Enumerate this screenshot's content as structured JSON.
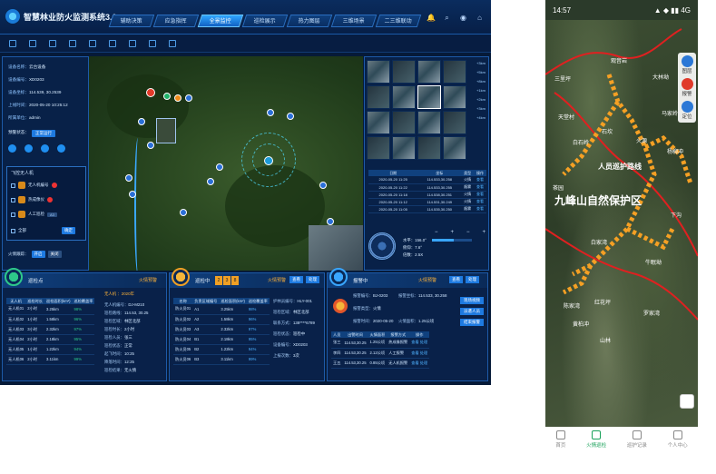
{
  "desktop": {
    "title": "智慧林业防火监测系统3.0",
    "nav_tabs": [
      "辅助决策",
      "应急指挥",
      "全景监控",
      "巡检展示",
      "热力图层",
      "三维场景",
      "二三维联动"
    ],
    "active_tab": 2,
    "left_panel": {
      "rows": [
        {
          "k": "设备名称：",
          "v": "云台设备"
        },
        {
          "k": "设备编号：",
          "v": "XD0203"
        },
        {
          "k": "设备坐标：",
          "v": "114.539, 30.2539"
        },
        {
          "k": "上线时间：",
          "v": "2020-05-20 10:25:12"
        },
        {
          "k": "所属单位：",
          "v": "admin"
        }
      ],
      "status_label": "预警状态：",
      "status_badge": "正常运行",
      "drone_section_title": "飞控无人机",
      "drones": [
        {
          "name": "无人机编号",
          "code": "A1"
        },
        {
          "name": "热成像仪",
          "code": "A2"
        },
        {
          "name": "人工巡检",
          "code": "A3"
        }
      ],
      "all_label": "全部",
      "all_btn": "确定",
      "follow_label": "火情跟踪：",
      "follow_btns": [
        "开启",
        "关闭"
      ]
    },
    "right_panel": {
      "ranges": [
        "+3km",
        "+5km",
        "+8km",
        "+1km",
        "+2km",
        "+3km",
        "+4km"
      ],
      "table_headers": [
        "日期",
        "坐标",
        "类型",
        "操作"
      ],
      "table_rows": [
        {
          "date": "2020-05-20 11:25",
          "coord": "114.533,30.258",
          "type": "火情",
          "op": "查看"
        },
        {
          "date": "2020-05-20 11:22",
          "coord": "114.533,30.255",
          "type": "烟雾",
          "op": "查看"
        },
        {
          "date": "2020-05-20 11:18",
          "coord": "114.538,30.251",
          "type": "火情",
          "op": "查看"
        },
        {
          "date": "2020-05-20 11:12",
          "coord": "114.531,30.249",
          "type": "火情",
          "op": "查看"
        },
        {
          "date": "2020-05-20 11:05",
          "coord": "114.535,30.250",
          "type": "烟雾",
          "op": "查看"
        }
      ],
      "dial": {
        "pan": "水平：156.0°",
        "tilt": "俯仰：7.6°",
        "zoom": "倍数：2.5X"
      },
      "slider_value": 0.55
    },
    "bottom": [
      {
        "title": "巡检点",
        "tag": "火情预警",
        "headers": [
          "无人机",
          "巡检时长",
          "巡检面积(km²)",
          "巡检覆盖率"
        ],
        "rows": [
          [
            "无人机01",
            "2小时",
            "3.25km",
            "98%"
          ],
          [
            "无人机02",
            "1小时",
            "1.58km",
            "96%"
          ],
          [
            "无人机03",
            "3小时",
            "2.32km",
            "97%"
          ],
          [
            "无人机04",
            "2小时",
            "2.18km",
            "95%"
          ],
          [
            "无人机05",
            "1小时",
            "1.22km",
            "94%"
          ],
          [
            "无人机06",
            "2小时",
            "3.11km",
            "99%"
          ]
        ],
        "detail_title": "无人机 ：2020年",
        "detail": [
          {
            "k": "无人机编号：",
            "v": "DJ-M210"
          },
          {
            "k": "巡检路线：",
            "v": "114.53, 30.25"
          },
          {
            "k": "巡检区域：",
            "v": "林区北部"
          },
          {
            "k": "巡检时长：",
            "v": "2小时"
          },
          {
            "k": "巡检人员：",
            "v": "张三"
          },
          {
            "k": "巡检状态：",
            "v": "正常"
          },
          {
            "k": "起飞时间：",
            "v": "10:25"
          },
          {
            "k": "降落时间：",
            "v": "12:25"
          },
          {
            "k": "巡检结果：",
            "v": "无火情"
          }
        ]
      },
      {
        "title": "巡检中",
        "counter": [
          "2",
          "3",
          "8"
        ],
        "tag": "火情预警",
        "btns": [
          "查看",
          "处理"
        ],
        "headers": [
          "名称",
          "负责区域编号",
          "巡检面积(km²)",
          "巡检覆盖率"
        ],
        "rows": [
          [
            "防火员01",
            "A1",
            "3.25km",
            "98%"
          ],
          [
            "防火员02",
            "A2",
            "1.58km",
            "96%"
          ],
          [
            "防火员03",
            "A3",
            "2.32km",
            "97%"
          ],
          [
            "防火员04",
            "B1",
            "2.18km",
            "95%"
          ],
          [
            "防火员05",
            "B2",
            "1.22km",
            "94%"
          ],
          [
            "防火员06",
            "B3",
            "3.11km",
            "99%"
          ]
        ],
        "detail": [
          {
            "k": "护林员编号：",
            "v": "HLY-001"
          },
          {
            "k": "巡检区域：",
            "v": "林区北部"
          },
          {
            "k": "联系方式：",
            "v": "138****6789"
          },
          {
            "k": "巡检状态：",
            "v": "巡检中"
          },
          {
            "k": "设备编号：",
            "v": "XD0203"
          },
          {
            "k": "上报次数：",
            "v": "3次"
          }
        ]
      },
      {
        "title": "报警中",
        "tag": "火情预警",
        "btns": [
          "查看",
          "处理"
        ],
        "fields": [
          {
            "k": "报警编号：",
            "v": "BJ-0203"
          },
          {
            "k": "报警坐标：",
            "v": "114.533, 30.258"
          },
          {
            "k": "报警类型：",
            "v": "火情"
          },
          {
            "k": "报警时间：",
            "v": "2020-05-20"
          },
          {
            "k": "火情面积：",
            "v": "1.25公顷"
          }
        ],
        "side_btns": [
          "现场视频",
          "派遣人员",
          "结束报警"
        ],
        "headers": [
          "人员",
          "出警时间",
          "火情面积",
          "报警方式",
          "操作"
        ],
        "rows": [
          [
            "张三",
            "114.53,30.25",
            "1.25公顷",
            "热成像报警",
            "查看 处理"
          ],
          [
            "李四",
            "114.53,30.25",
            "2.12公顷",
            "人工报警",
            "查看 处理"
          ],
          [
            "王五",
            "114.53,30.25",
            "0.85公顷",
            "无人机报警",
            "查看 处理"
          ]
        ]
      }
    ]
  },
  "phone": {
    "time": "14:57",
    "signal_text": "▲ ◆ ▮▮ 4G",
    "map_labels": [
      "观音岩",
      "三里坪",
      "大林坳",
      "天堂村",
      "马家岭",
      "白石岭",
      "杨柳冲",
      "石坎",
      "火源",
      "茶园",
      "下沟",
      "白家湾",
      "牛眠坳",
      "陈家湾",
      "红花坪",
      "罗家湾",
      "黄柏冲",
      "山林"
    ],
    "big_labels": [
      "人员巡护路线",
      "九峰山自然保护区"
    ],
    "side_tools": [
      {
        "label": "图层",
        "color": "#2b78d6"
      },
      {
        "label": "报警",
        "color": "#e03a2a"
      },
      {
        "label": "定位",
        "color": "#2b78d6"
      }
    ],
    "tabs": [
      "首页",
      "火情巡检",
      "巡护记录",
      "个人中心"
    ],
    "active_tab": 1
  }
}
